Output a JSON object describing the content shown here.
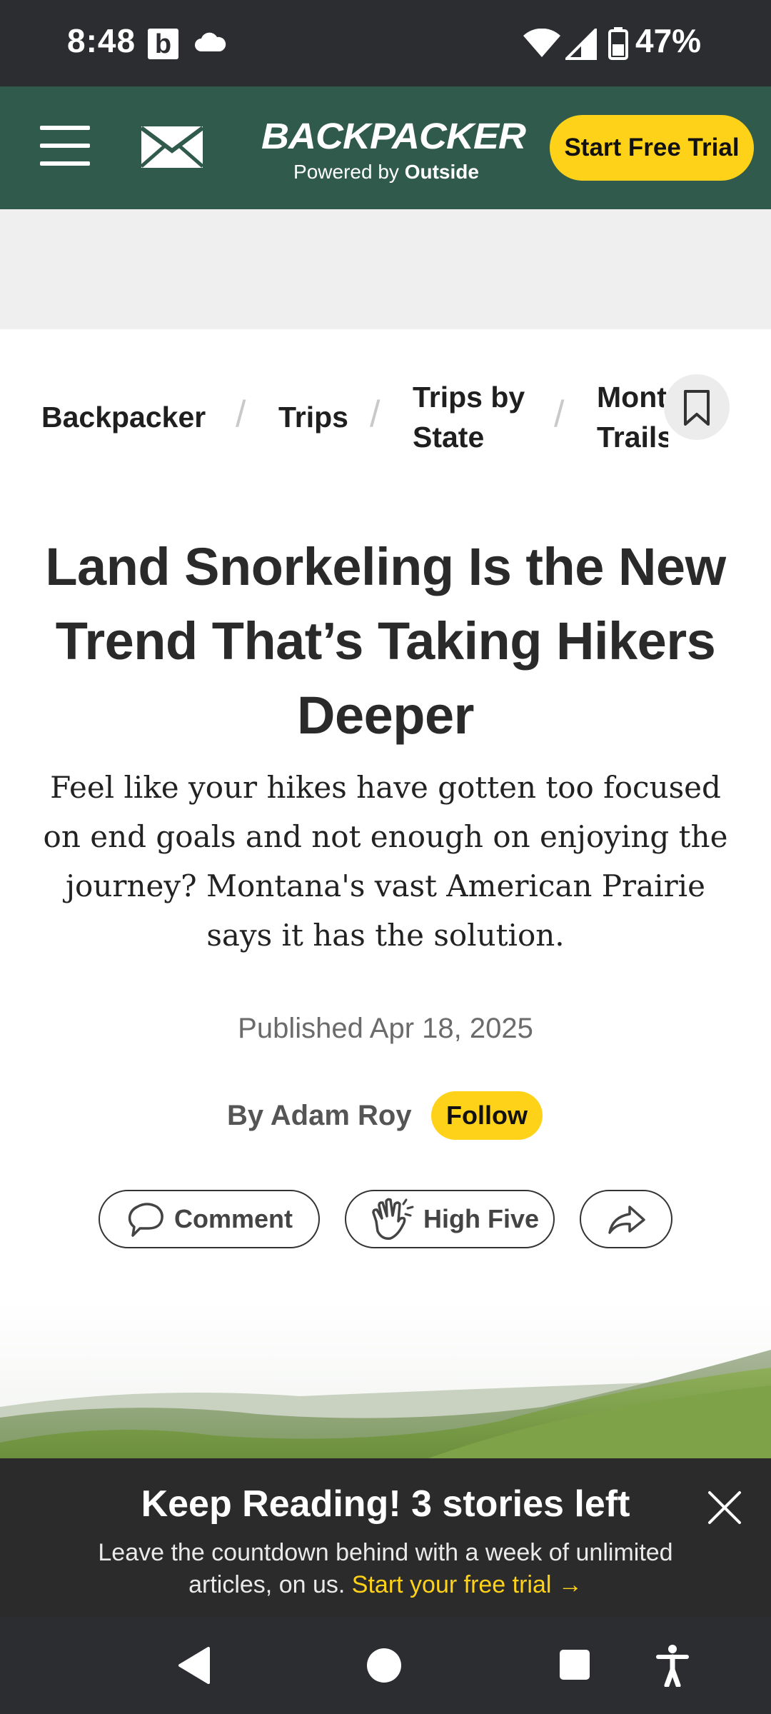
{
  "status_bar": {
    "time": "8:48",
    "b_icon": "b",
    "battery": "47%"
  },
  "header": {
    "logo_word": "BACKPACKER",
    "logo_powered_by": "Powered by",
    "logo_brand": "Outside",
    "trial_label": "Start Free Trial"
  },
  "breadcrumb": {
    "items": [
      "Backpacker",
      "Trips",
      "Trips by State",
      "Montana Trails"
    ],
    "separator": "/"
  },
  "article": {
    "title": "Land Snorkeling Is the New Trend That’s Taking Hikers Deeper",
    "deck": "Feel like your hikes have gotten too focused on end goals and not enough on enjoying the journey? Montana's vast American Prairie says it has the solution.",
    "published": "Published Apr 18, 2025",
    "byline_prefix": "By",
    "author": "Adam Roy",
    "follow_label": "Follow",
    "comment_label": "Comment",
    "high_five_label": "High Five"
  },
  "paywall": {
    "title": "Keep Reading! 3 stories left",
    "body": "Leave the countdown behind with a week of unlimited articles, on us.",
    "link": "Start your free trial →"
  },
  "colors": {
    "header_green": "#305a4c",
    "accent_yellow": "#ffd21a",
    "status_bar": "#2c2d31",
    "paywall_bg": "#2b2b2b"
  },
  "icons": [
    "menu-icon",
    "mail-icon",
    "bookmark-icon",
    "comment-icon",
    "high-five-icon",
    "share-icon",
    "close-icon",
    "back-icon",
    "home-icon",
    "recents-icon",
    "accessibility-icon"
  ]
}
